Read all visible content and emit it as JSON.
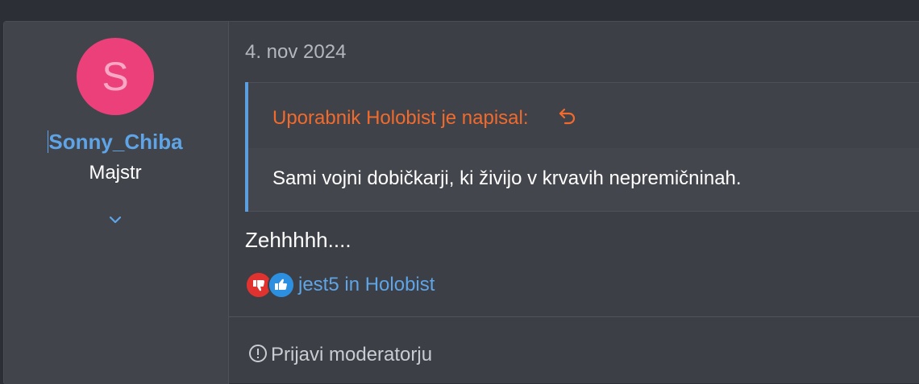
{
  "user": {
    "avatar_letter": "S",
    "name": "Sonny_Chiba",
    "title": "Majstr"
  },
  "post": {
    "date": "4. nov 2024",
    "quote": {
      "author_line": "Uporabnik Holobist je napisal:",
      "text": "Sami vojni dobičkarji, ki živijo v krvavih nepremičninah."
    },
    "message": "Zehhhhh....",
    "reactions": {
      "users": "jest5 in Holobist",
      "icons": [
        "thumbs-down-icon",
        "thumbs-up-icon"
      ]
    },
    "report_label": "Prijavi moderatorju"
  },
  "colors": {
    "avatar_bg": "#ec407a",
    "link": "#5ea4e6",
    "quote_author": "#f26a2c",
    "quote_border": "#5b9fe0"
  }
}
